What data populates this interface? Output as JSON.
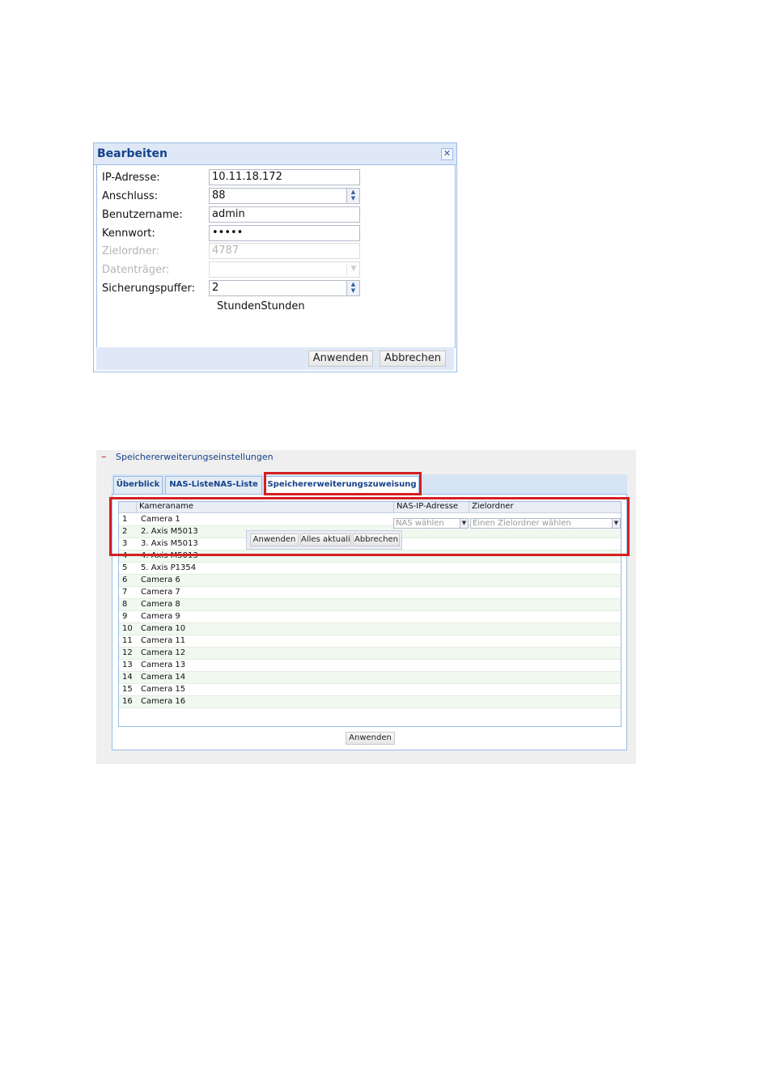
{
  "dialog": {
    "title": "Bearbeiten",
    "close_icon": "close-icon",
    "fields": [
      {
        "label": "IP-Adresse:",
        "value": "10.11.18.172",
        "disabled": false
      },
      {
        "label": "Anschluss:",
        "value": "88",
        "disabled": false
      },
      {
        "label": "Benutzername:",
        "value": "admin",
        "disabled": false
      },
      {
        "label": "Kennwort:",
        "value": "•••••",
        "disabled": false
      },
      {
        "label": "Zielordner:",
        "value": "4787",
        "disabled": true
      },
      {
        "label": "Datenträger:",
        "value": "",
        "disabled": true
      },
      {
        "label": "Sicherungspuffer:",
        "value": "2",
        "disabled": false
      }
    ],
    "unit_text": "StundenStunden",
    "buttons": {
      "apply": "Anwenden",
      "cancel": "Abbrechen"
    }
  },
  "panel": {
    "collapse_symbol": "–",
    "title": "Speichererweiterungseinstellungen",
    "tabs": [
      {
        "label": "Überblick",
        "active": false
      },
      {
        "label": "NAS-ListeNAS-Liste",
        "active": false
      },
      {
        "label": "Speichererweiterungszuweisung",
        "active": true
      }
    ],
    "grid": {
      "headers": [
        "Kameraname",
        "NAS-IP-Adresse",
        "Zielordner"
      ],
      "rows": [
        {
          "num": "1",
          "name": "Camera 1"
        },
        {
          "num": "2",
          "name": "2. Axis M5013"
        },
        {
          "num": "3",
          "name": "3. Axis M5013"
        },
        {
          "num": "4",
          "name": "4. Axis M5013"
        },
        {
          "num": "5",
          "name": "5. Axis P1354"
        },
        {
          "num": "6",
          "name": "Camera 6"
        },
        {
          "num": "7",
          "name": "Camera 7"
        },
        {
          "num": "8",
          "name": "Camera 8"
        },
        {
          "num": "9",
          "name": "Camera 9"
        },
        {
          "num": "10",
          "name": "Camera 10"
        },
        {
          "num": "11",
          "name": "Camera 11"
        },
        {
          "num": "12",
          "name": "Camera 12"
        },
        {
          "num": "13",
          "name": "Camera 13"
        },
        {
          "num": "14",
          "name": "Camera 14"
        },
        {
          "num": "15",
          "name": "Camera 15"
        },
        {
          "num": "16",
          "name": "Camera 16"
        }
      ],
      "row_editor": {
        "nas_placeholder": "NAS wählen",
        "folder_placeholder": "Einen Zielordner wählen",
        "buttons": {
          "apply": "Anwenden",
          "update_all": "Alles aktualis",
          "cancel": "Abbrechen"
        }
      }
    },
    "apply_button": "Anwenden"
  },
  "colors": {
    "highlight": "#d42020",
    "header_text": "#15428b",
    "row_alt": "#f0f9ef"
  }
}
